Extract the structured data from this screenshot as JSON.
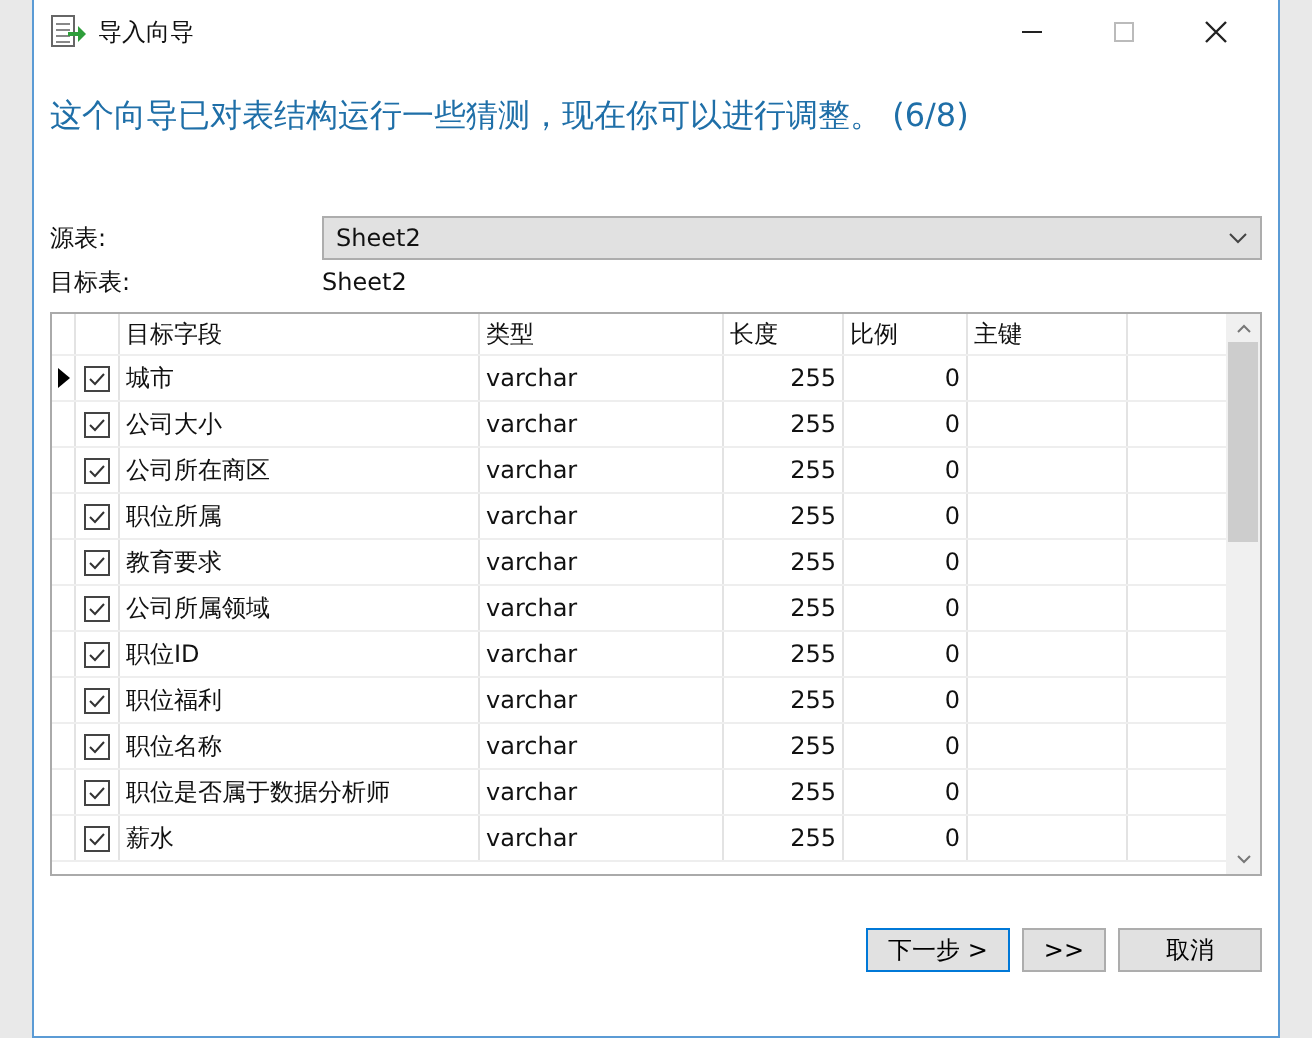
{
  "window": {
    "title": "导入向导"
  },
  "heading": "这个向导已对表结构运行一些猜测，现在你可以进行调整。 (6/8)",
  "source": {
    "label": "源表:",
    "value": "Sheet2"
  },
  "target": {
    "label": "目标表:",
    "value": "Sheet2"
  },
  "table": {
    "columns": [
      "目标字段",
      "类型",
      "长度",
      "比例",
      "主键"
    ],
    "rows": [
      {
        "current": true,
        "checked": true,
        "cells": [
          "城市",
          "varchar",
          "255",
          "0"
        ]
      },
      {
        "current": false,
        "checked": true,
        "cells": [
          "公司大小",
          "varchar",
          "255",
          "0"
        ]
      },
      {
        "current": false,
        "checked": true,
        "cells": [
          "公司所在商区",
          "varchar",
          "255",
          "0"
        ]
      },
      {
        "current": false,
        "checked": true,
        "cells": [
          "职位所属",
          "varchar",
          "255",
          "0"
        ]
      },
      {
        "current": false,
        "checked": true,
        "cells": [
          "教育要求",
          "varchar",
          "255",
          "0"
        ]
      },
      {
        "current": false,
        "checked": true,
        "cells": [
          "公司所属领域",
          "varchar",
          "255",
          "0"
        ]
      },
      {
        "current": false,
        "checked": true,
        "cells": [
          "职位ID",
          "varchar",
          "255",
          "0"
        ]
      },
      {
        "current": false,
        "checked": true,
        "cells": [
          "职位福利",
          "varchar",
          "255",
          "0"
        ]
      },
      {
        "current": false,
        "checked": true,
        "cells": [
          "职位名称",
          "varchar",
          "255",
          "0"
        ]
      },
      {
        "current": false,
        "checked": true,
        "cells": [
          "职位是否属于数据分析师",
          "varchar",
          "255",
          "0"
        ]
      },
      {
        "current": false,
        "checked": true,
        "cells": [
          "薪水",
          "varchar",
          "255",
          "0"
        ]
      }
    ]
  },
  "buttons": [
    {
      "label": "下一步 >",
      "default": true
    },
    {
      "label": ">>",
      "default": false
    },
    {
      "label": "取消",
      "default": false
    }
  ]
}
